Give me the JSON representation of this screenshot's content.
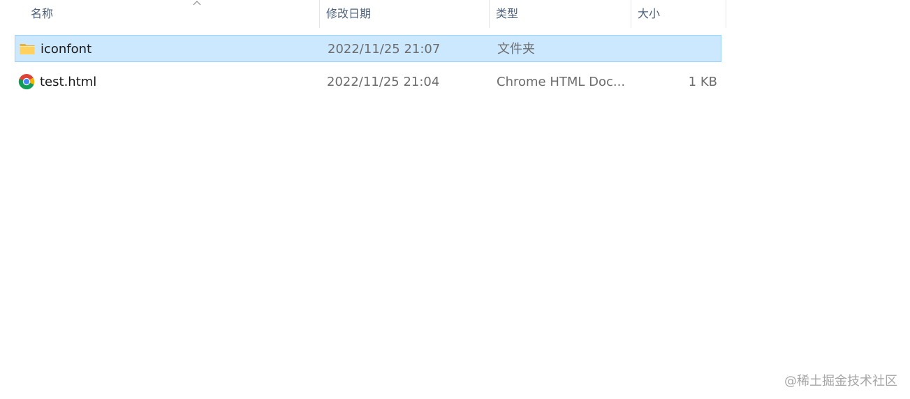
{
  "columns": {
    "name": "名称",
    "date": "修改日期",
    "type": "类型",
    "size": "大小"
  },
  "sort": {
    "column": "name",
    "direction": "ascending",
    "icon": "chevron-up-icon"
  },
  "files": [
    {
      "name": "iconfont",
      "date": "2022/11/25 21:07",
      "type": "文件夹",
      "size": "",
      "icon": "folder-icon",
      "selected": true
    },
    {
      "name": "test.html",
      "date": "2022/11/25 21:04",
      "type": "Chrome HTML Doc...",
      "size": "1 KB",
      "icon": "chrome-icon",
      "selected": false
    }
  ],
  "watermark": "@稀土掘金技术社区",
  "colors": {
    "selection_bg": "#cce8ff",
    "selection_border": "#99d1ff",
    "header_text": "#4c607a",
    "secondary_text": "#6d6d6d"
  }
}
